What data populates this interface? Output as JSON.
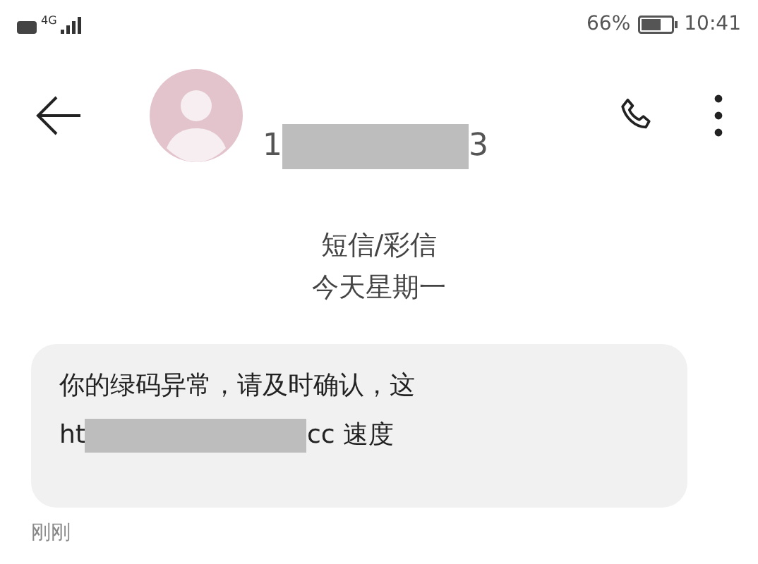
{
  "status_bar": {
    "network": "4G",
    "battery_percent": "66%",
    "time": "10:41"
  },
  "header": {
    "number_start": "1",
    "number_end": "3"
  },
  "thread_info": {
    "type": "短信/彩信",
    "date": "今天星期一"
  },
  "messages": [
    {
      "lines": [
        [
          "你的绿码异常，请及时确认，这"
        ],
        [
          "ht",
          "cc 速度"
        ]
      ],
      "time": "刚刚"
    }
  ]
}
